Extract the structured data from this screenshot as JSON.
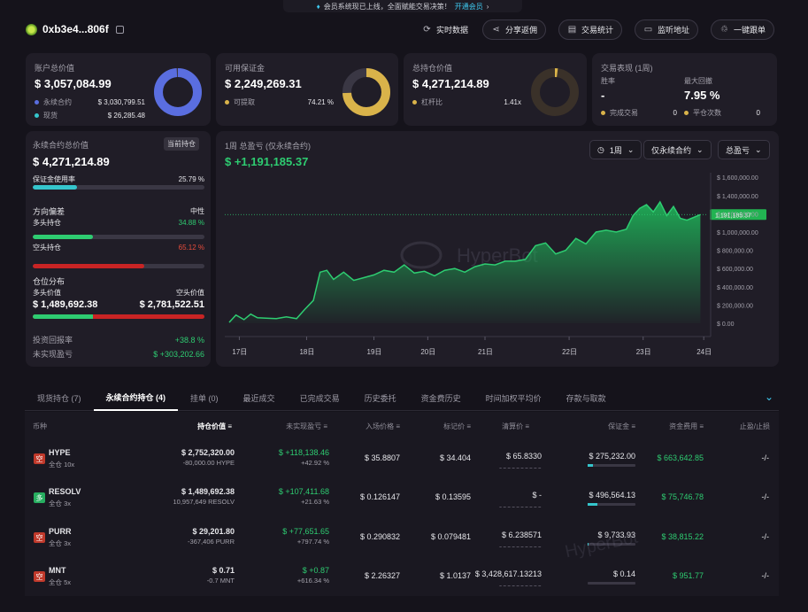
{
  "banner": {
    "text": "会员系统现已上线，全面赋能交易决策！",
    "link": "开通会员"
  },
  "header": {
    "address": "0xb3e4...806f",
    "buttons": [
      "实时数据",
      "分享返佣",
      "交易统计",
      "监听地址",
      "一键跟单"
    ]
  },
  "account": {
    "title": "账户总价值",
    "value": "$ 3,057,084.99",
    "rows": [
      {
        "label": "永续合约",
        "value": "$ 3,030,799.51"
      },
      {
        "label": "现货",
        "value": "$ 26,285.48"
      }
    ],
    "ring_fraction": 0.99
  },
  "margin": {
    "title": "可用保证金",
    "value": "$ 2,249,269.31",
    "row_label": "可提取",
    "row_value": "74.21 %",
    "ring_fraction": 0.7421
  },
  "holdings": {
    "title": "总持仓价值",
    "value": "$ 4,271,214.89",
    "row_label": "杠杆比",
    "row_value": "1.41x",
    "ring_fraction": 0.02
  },
  "performance": {
    "title": "交易表现 (1周)",
    "win_label": "胜率",
    "win_value": "-",
    "dd_label": "最大回撤",
    "dd_value": "7.95 %",
    "closed_label": "完成交易",
    "closed_value": "0",
    "flat_label": "平仓次数",
    "flat_value": "0"
  },
  "perp": {
    "title": "永续合约总价值",
    "badge": "当前持仓",
    "value": "$ 4,271,214.89",
    "util_label": "保证金使用率",
    "util_value": "25.79 %",
    "util_fraction": 0.2579,
    "dir_label": "方向偏差",
    "dir_value": "中性",
    "long_label": "多头持仓",
    "long_value": "34.88 %",
    "long_fraction": 0.3488,
    "short_label": "空头持仓",
    "short_value": "65.12 %",
    "short_fraction": 0.6512,
    "dist_label": "仓位分布",
    "long_val_label": "多头价值",
    "long_val": "$ 1,489,692.38",
    "short_val_label": "空头价值",
    "short_val": "$ 2,781,522.51",
    "dist_long_fraction": 0.3488,
    "roi_label": "投资回报率",
    "roi_value": "+38.8 %",
    "upnl_label": "未实现盈亏",
    "upnl_value": "$ +303,202.66"
  },
  "pnl_chart": {
    "title": "1周 总盈亏 (仅永续合约)",
    "value": "$ +1,191,185.37",
    "dropdowns": [
      "1周",
      "仅永续合约",
      "总盈亏"
    ],
    "watermark": "HyperBot"
  },
  "chart_data": {
    "type": "area",
    "x_ticks": [
      "17日",
      "18日",
      "19日",
      "20日",
      "21日",
      "22日",
      "23日",
      "24日"
    ],
    "y_ticks": [
      "1,600,000.00",
      "1,400,000.00",
      "1,200,000.00",
      "1,000,000.00",
      "800,000.00",
      "600,000.00",
      "400,000.00",
      "200,000.00",
      "0.00"
    ],
    "ylim": [
      0,
      1650000
    ],
    "xlim": [
      0,
      7.1
    ],
    "current_label": "1,191,185.37",
    "current_value": 1191185,
    "series": [
      {
        "x": [
          0,
          0.1,
          0.22,
          0.32,
          0.42,
          0.55,
          0.7,
          0.85,
          1,
          1.12,
          1.25,
          1.35,
          1.45,
          1.55,
          1.7,
          1.85,
          2,
          2.15,
          2.3,
          2.45,
          2.6,
          2.75,
          2.9,
          3.05,
          3.2,
          3.35,
          3.5,
          3.65,
          3.8,
          3.95,
          4.1,
          4.25,
          4.4,
          4.55,
          4.7,
          4.85,
          5,
          5.15,
          5.3,
          5.45,
          5.6,
          5.75,
          5.9,
          6,
          6.1,
          6.2,
          6.3,
          6.4,
          6.5,
          6.6,
          6.7,
          6.8,
          6.9,
          7.0
        ],
        "values": [
          10000,
          90000,
          40000,
          100000,
          60000,
          55000,
          50000,
          70000,
          50000,
          150000,
          250000,
          560000,
          580000,
          480000,
          560000,
          470000,
          500000,
          530000,
          580000,
          560000,
          640000,
          550000,
          570000,
          520000,
          580000,
          600000,
          560000,
          620000,
          650000,
          640000,
          680000,
          680000,
          700000,
          850000,
          880000,
          760000,
          800000,
          930000,
          870000,
          1000000,
          1020000,
          1000000,
          1030000,
          1180000,
          1260000,
          1300000,
          1220000,
          1330000,
          1180000,
          1280000,
          1150000,
          1130000,
          1160000,
          1191185
        ]
      }
    ]
  },
  "tabs": [
    "现货持仓 (7)",
    "永续合约持仓 (4)",
    "挂单 (0)",
    "最近成交",
    "已完成交易",
    "历史委托",
    "资金费历史",
    "时间加权平均价",
    "存款与取款"
  ],
  "table": {
    "headers": [
      "币种",
      "持仓价值",
      "未实现盈亏",
      "入场价格",
      "标记价",
      "清算价",
      "保证金",
      "资金费用",
      "止盈/止损"
    ],
    "rows": [
      {
        "badge": "空",
        "badge_color": "#c0392b",
        "coin": "HYPE",
        "mode": "全仓 10x",
        "value": "$ 2,752,320.00",
        "size": "-80,000.00 HYPE",
        "pnl": "$ +118,138.46",
        "pnl_pct": "+42.92 %",
        "entry": "$ 35.8807",
        "mark": "$ 34.404",
        "liq": "$ 65.8330",
        "margin": "$ 275,232.00",
        "margin_fraction": 0.12,
        "funding": "$ 663,642.85",
        "tpsl": "-/-"
      },
      {
        "badge": "多",
        "badge_color": "#27ae60",
        "coin": "RESOLV",
        "mode": "全仓 3x",
        "value": "$ 1,489,692.38",
        "size": "10,957,649 RESOLV",
        "pnl": "$ +107,411.68",
        "pnl_pct": "+21.63 %",
        "entry": "$ 0.126147",
        "mark": "$ 0.13595",
        "liq": "$ -",
        "margin": "$ 496,564.13",
        "margin_fraction": 0.2,
        "funding": "$ 75,746.78",
        "tpsl": "-/-"
      },
      {
        "badge": "空",
        "badge_color": "#c0392b",
        "coin": "PURR",
        "mode": "全仓 3x",
        "value": "$ 29,201.80",
        "size": "-367,406 PURR",
        "pnl": "$ +77,651.65",
        "pnl_pct": "+797.74 %",
        "entry": "$ 0.290832",
        "mark": "$ 0.079481",
        "liq": "$ 6.238571",
        "margin": "$ 9,733.93",
        "margin_fraction": 0.02,
        "funding": "$ 38,815.22",
        "tpsl": "-/-"
      },
      {
        "badge": "空",
        "badge_color": "#c0392b",
        "coin": "MNT",
        "mode": "全仓 5x",
        "value": "$ 0.71",
        "size": "-0.7 MNT",
        "pnl": "$ +0.87",
        "pnl_pct": "+616.34 %",
        "entry": "$ 2.26327",
        "mark": "$ 1.0137",
        "liq": "$ 3,428,617.13213",
        "margin": "$ 0.14",
        "margin_fraction": 0.0,
        "funding": "$ 951.77",
        "tpsl": "-/-"
      }
    ]
  },
  "colors": {
    "accent": "#2ecc71",
    "account_ring": "#5a6ee0",
    "margin_ring": "#d9b34a",
    "short": "#c82424",
    "util": "#35c5cc"
  }
}
